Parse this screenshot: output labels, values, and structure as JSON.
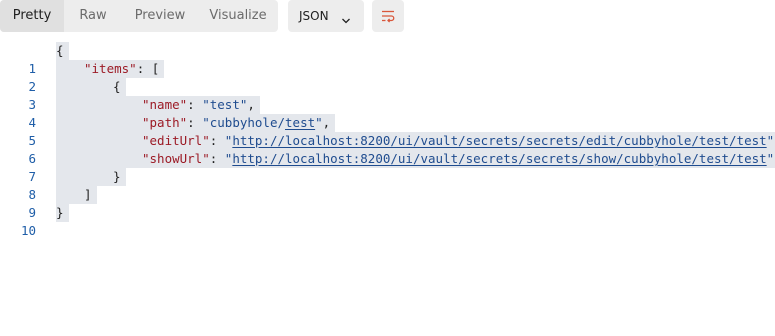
{
  "toolbar": {
    "tabs": [
      {
        "label": "Pretty",
        "active": true
      },
      {
        "label": "Raw",
        "active": false
      },
      {
        "label": "Preview",
        "active": false
      },
      {
        "label": "Visualize",
        "active": false
      }
    ],
    "format": {
      "selected": "JSON",
      "icon": "chevron-down-icon"
    },
    "wrap_icon": "wrap-lines-icon",
    "accent_color": "#d9573b"
  },
  "editor": {
    "line_numbers": [
      "1",
      "2",
      "3",
      "4",
      "5",
      "6",
      "7",
      "8",
      "9",
      "10"
    ],
    "open_brace": "{",
    "close_brace": "}",
    "items_key": "\"items\"",
    "items_open": ": [",
    "items_close": "]",
    "obj_open": "{",
    "obj_close": "}",
    "fields": [
      {
        "key": "\"name\"",
        "value": "\"test\"",
        "trail": ","
      },
      {
        "key": "\"path\"",
        "value_prefix": "\"cubbyhole/",
        "value_link": "test",
        "value_suffix": "\"",
        "trail": ","
      },
      {
        "key": "\"editUrl\"",
        "value_link": "http://localhost:8200/ui/vault/secrets/secrets/edit/cubbyhole/test/test",
        "trail": ","
      },
      {
        "key": "\"showUrl\"",
        "value_link": "http://localhost:8200/ui/vault/secrets/secrets/show/cubbyhole/test/test",
        "trail": ""
      }
    ],
    "colors": {
      "key": "#9c1b26",
      "string": "#1f4c8f",
      "line_number": "#1f5ea8",
      "selection": "#e4e7ec"
    }
  }
}
